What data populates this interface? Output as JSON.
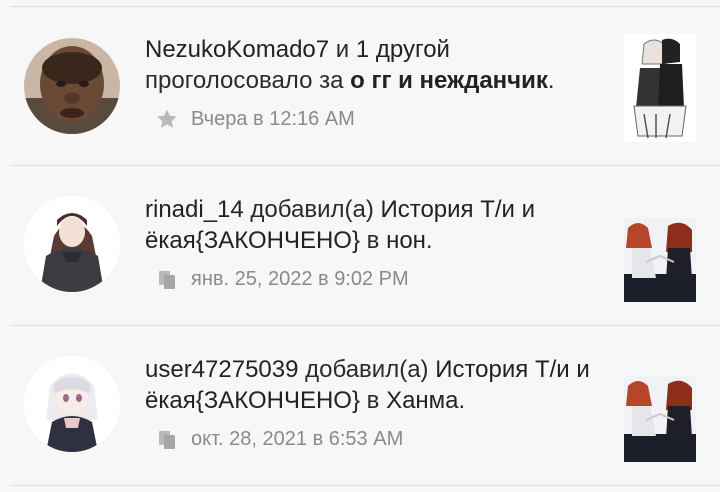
{
  "feed": {
    "items": [
      {
        "actor": "NezukoKomado7",
        "connector": "и",
        "extra": "1 другой",
        "action": "проголосовало за",
        "target": "о гг и нежданчик",
        "tail": ".",
        "meta_icon": "star-icon",
        "timestamp": "Вчера в 12:16 AM"
      },
      {
        "actor": "rinadi_14",
        "action": "добавил(а)",
        "target": "История Т/и и ёкая{ЗАКОНЧЕНО}",
        "preposition": "в",
        "list": "нон",
        "tail": ".",
        "meta_icon": "copy-icon",
        "timestamp": "янв. 25, 2022 в 9:02 PM"
      },
      {
        "actor": "user47275039",
        "action": "добавил(а)",
        "target": "История Т/и и ёкая{ЗАКОНЧЕНО}",
        "preposition": "в",
        "list": "Ханма",
        "tail": ".",
        "meta_icon": "copy-icon",
        "timestamp": "окт. 28, 2021 в 6:53 AM"
      }
    ]
  },
  "colors": {
    "background": "#f7f7f7",
    "divider": "#dedede",
    "text": "#222222",
    "meta": "#8a8a8a"
  }
}
